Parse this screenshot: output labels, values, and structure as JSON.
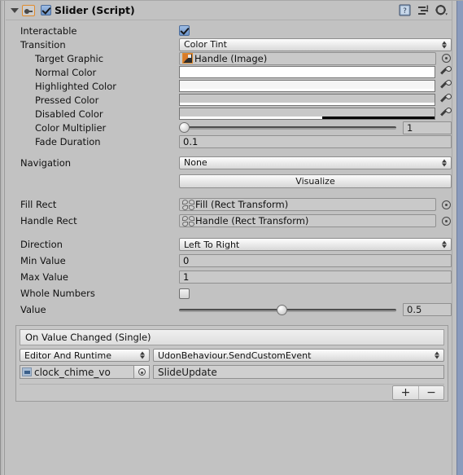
{
  "header": {
    "foldout": "expanded",
    "enabled": true,
    "title": "Slider (Script)",
    "icons": [
      "help-icon",
      "preset-icon",
      "gear-icon"
    ]
  },
  "properties": {
    "interactable": {
      "label": "Interactable",
      "checked": true
    },
    "transition": {
      "label": "Transition",
      "value": "Color Tint"
    },
    "target_graphic": {
      "label": "Target Graphic",
      "value": "Handle (Image)"
    },
    "normal_color": {
      "label": "Normal Color",
      "color": "#FFFFFF",
      "alpha": 100
    },
    "highlighted_color": {
      "label": "Highlighted Color",
      "color": "#F5F5F5",
      "alpha": 100
    },
    "pressed_color": {
      "label": "Pressed Color",
      "color": "#C8C8C8",
      "alpha": 100
    },
    "disabled_color": {
      "label": "Disabled Color",
      "color": "#C8C8C8",
      "alpha": 50
    },
    "color_multiplier": {
      "label": "Color Multiplier",
      "value": "1",
      "slider_pct": 0
    },
    "fade_duration": {
      "label": "Fade Duration",
      "value": "0.1"
    },
    "navigation": {
      "label": "Navigation",
      "value": "None"
    },
    "visualize": {
      "label": "Visualize"
    },
    "fill_rect": {
      "label": "Fill Rect",
      "value": "Fill (Rect Transform)"
    },
    "handle_rect": {
      "label": "Handle Rect",
      "value": "Handle (Rect Transform)"
    },
    "direction": {
      "label": "Direction",
      "value": "Left To Right"
    },
    "min_value": {
      "label": "Min Value",
      "value": "0"
    },
    "max_value": {
      "label": "Max Value",
      "value": "1"
    },
    "whole_numbers": {
      "label": "Whole Numbers",
      "checked": false
    },
    "value": {
      "label": "Value",
      "value": "0.5",
      "slider_pct": 48
    }
  },
  "event": {
    "title": "On Value Changed (Single)",
    "call_state": "Editor And Runtime",
    "function": "UdonBehaviour.SendCustomEvent",
    "object": "clock_chime_vo",
    "argument": "SlideUpdate",
    "add_label": "+",
    "remove_label": "−"
  },
  "colors": {
    "background": "#C2C2C2",
    "accent_orange": "#E08B2D",
    "checkbox_blue": "#6D94C9",
    "right_rail": "#8A9BBD"
  }
}
